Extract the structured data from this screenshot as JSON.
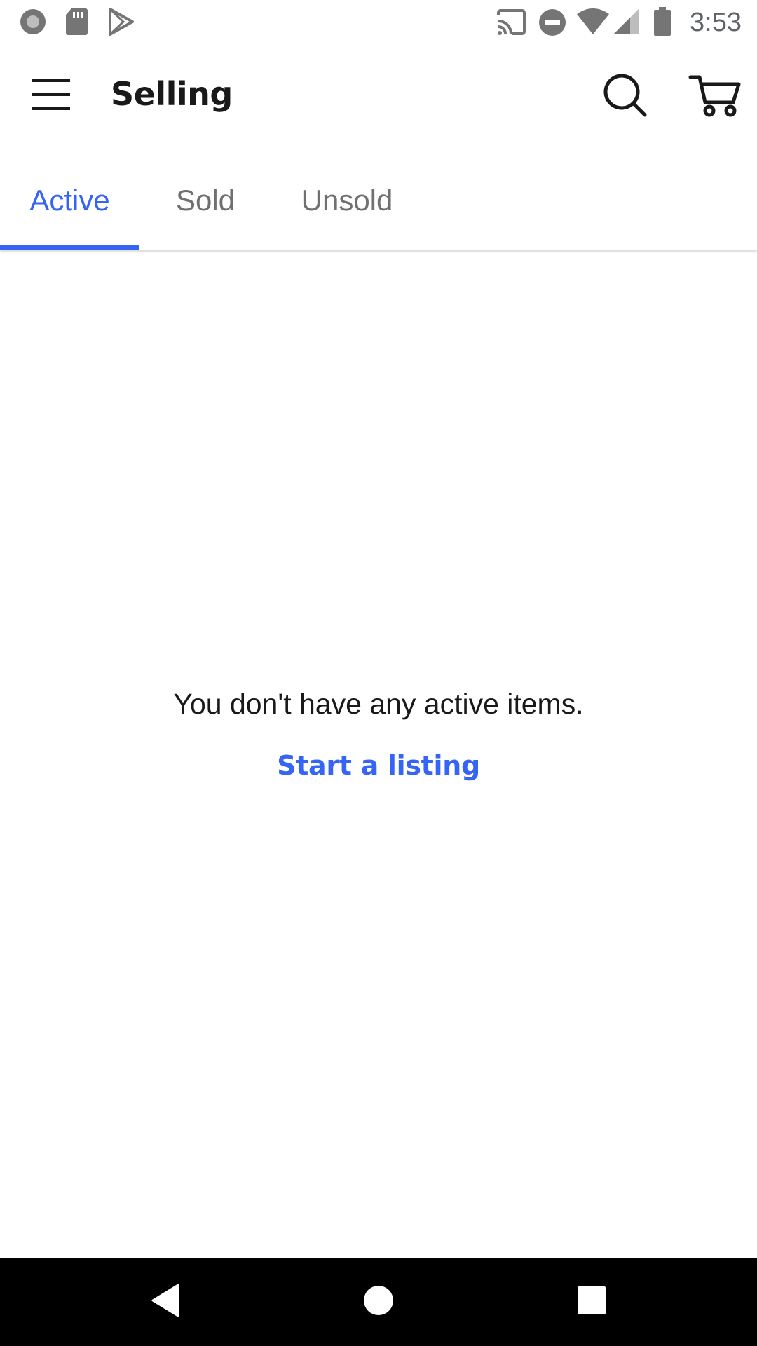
{
  "status_bar": {
    "time": "3:53",
    "left_icons": [
      "notification-dot-icon",
      "sd-card-icon",
      "play-store-icon"
    ],
    "right_icons": [
      "cast-icon",
      "do-not-disturb-icon",
      "wifi-icon",
      "cell-signal-icon",
      "battery-icon"
    ]
  },
  "app_bar": {
    "title": "Selling",
    "menu_icon": "hamburger-menu-icon",
    "search_icon": "search-icon",
    "cart_icon": "cart-icon"
  },
  "tabs": [
    {
      "label": "Active",
      "selected": true
    },
    {
      "label": "Sold",
      "selected": false
    },
    {
      "label": "Unsold",
      "selected": false
    }
  ],
  "empty_state": {
    "message": "You don't have any active items.",
    "action_label": "Start a listing"
  },
  "nav_bar": {
    "buttons": [
      "back-icon",
      "home-icon",
      "recents-icon"
    ]
  },
  "colors": {
    "accent": "#3665f3",
    "text_primary": "#191919",
    "text_secondary": "#707070",
    "nav_background": "#000000"
  }
}
